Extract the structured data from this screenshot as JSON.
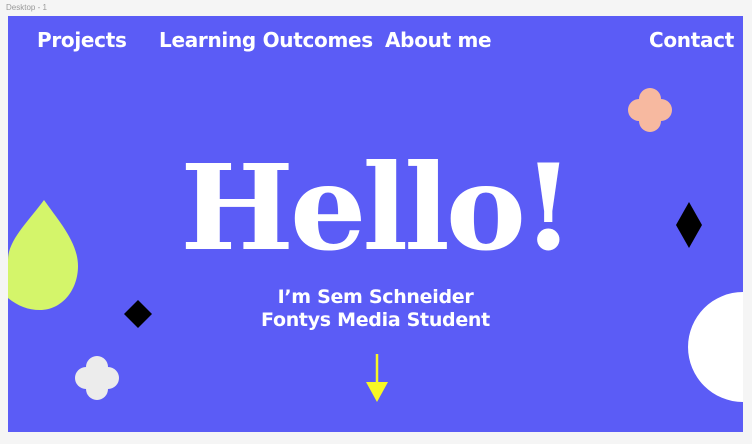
{
  "frame": {
    "label": "Desktop - 1"
  },
  "nav": {
    "projects": "Projects",
    "learning_outcomes": "Learning Outcomes",
    "about_me": "About me",
    "contact": "Contact"
  },
  "hero": {
    "title": "Hello!",
    "name_line": "I’m Sem Schneider",
    "role_line": "Fontys Media Student"
  },
  "colors": {
    "background": "#5b5cf6",
    "flower_peach": "#f7b9a0",
    "drop_lime": "#d4f56a",
    "flower_light": "#ececec",
    "diamond": "#000000",
    "arrow": "#f7f724",
    "half_circle": "#ffffff"
  },
  "icons": {
    "scroll": "arrow-down-icon"
  }
}
